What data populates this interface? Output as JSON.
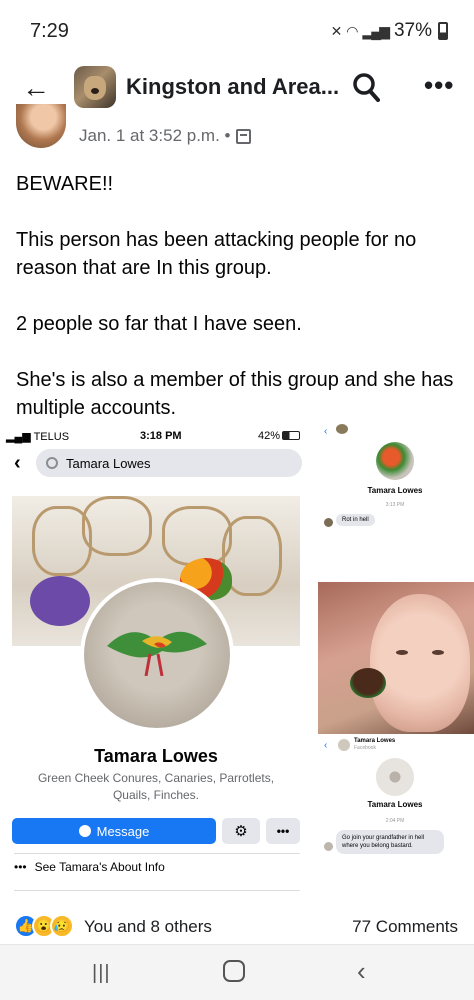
{
  "status_bar": {
    "time": "7:29",
    "battery": "37%"
  },
  "header": {
    "title": "Kingston and Area..."
  },
  "post": {
    "timestamp": "Jan. 1 at 3:52 p.m. •",
    "paragraphs": [
      "BEWARE!!",
      "This person has been attacking people for no reason that are In this group.",
      "2 people so far that I have seen.",
      "She's is also a member of this group and she has multiple accounts."
    ]
  },
  "screenshot_profile": {
    "carrier": "TELUS",
    "time": "3:18 PM",
    "battery": "42%",
    "search_value": "Tamara Lowes",
    "name": "Tamara Lowes",
    "description": "Green Cheek Conures, Canaries, Parrotlets, Quails, Finches.",
    "message_label": "Message",
    "about_label": "See Tamara's About Info"
  },
  "screenshot_chat_1": {
    "name": "Tamara Lowes",
    "stamp": "3:13 PM",
    "message": "Rot in hell"
  },
  "screenshot_chat_2": {
    "header_name": "Tamara Lowes",
    "header_sub": "Facebook",
    "name": "Tamara Lowes",
    "stamp": "2:04 PM",
    "message": "Go join your grandfather in hell where you belong bastard."
  },
  "reactions": {
    "text": "You and 8 others",
    "comments": "77 Comments"
  },
  "colors": {
    "brand_blue": "#1877f2",
    "text": "#050505",
    "secondary": "#65676b"
  },
  "icons": [
    "back-arrow-icon",
    "search-icon",
    "more-icon",
    "group-icon",
    "like-icon",
    "wow-icon",
    "sad-icon",
    "recents-icon",
    "home-icon",
    "nav-back-icon"
  ]
}
